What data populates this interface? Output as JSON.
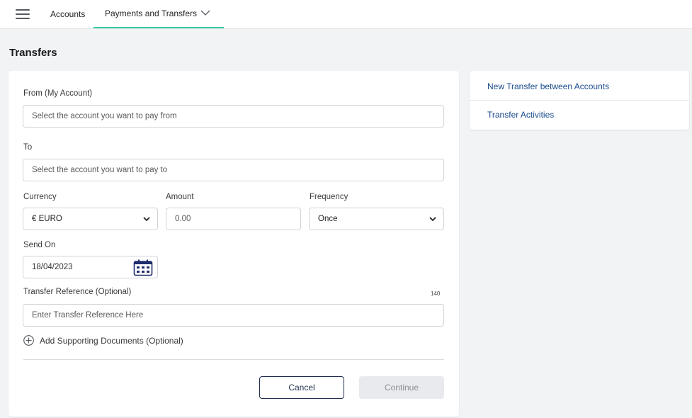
{
  "nav": {
    "tabs": [
      {
        "label": "Accounts",
        "active": false
      },
      {
        "label": "Payments and Transfers",
        "active": true
      }
    ],
    "active_underline_color": "#3ac7a4"
  },
  "page": {
    "title": "Transfers"
  },
  "form": {
    "from": {
      "label": "From (My Account)",
      "placeholder": "Select the account you want to pay from"
    },
    "to": {
      "label": "To",
      "placeholder": "Select the account you want to pay to"
    },
    "currency": {
      "label": "Currency",
      "selected": "€ EURO"
    },
    "amount": {
      "label": "Amount",
      "placeholder": "0.00"
    },
    "frequency": {
      "label": "Frequency",
      "selected": "Once"
    },
    "send_on": {
      "label": "Send On",
      "value": "18/04/2023"
    },
    "reference": {
      "label": "Transfer Reference (Optional)",
      "counter": "140",
      "placeholder": "Enter Transfer Reference Here"
    },
    "add_documents_label": "Add Supporting Documents (Optional)",
    "cancel_label": "Cancel",
    "continue_label": "Continue"
  },
  "side_panel": {
    "links": [
      "New Transfer between Accounts",
      "Transfer Activities"
    ]
  },
  "icons": {
    "menu": "hamburger-menu-icon",
    "chevron": "chevron-down-icon",
    "calendar": "calendar-icon",
    "add": "plus-circle-icon"
  }
}
